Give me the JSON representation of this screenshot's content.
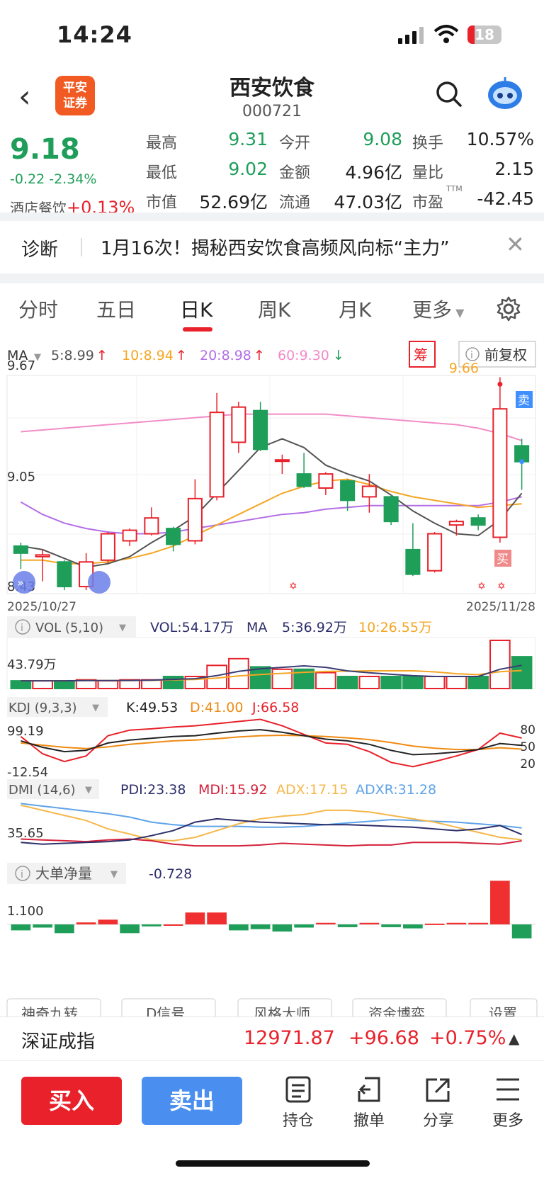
{
  "status": {
    "time": "14:24",
    "battery": "18"
  },
  "header": {
    "back_icon": "chevron-left-icon",
    "logo_text_1": "平安",
    "logo_text_2": "证券",
    "title": "西安饮食",
    "code": "000721",
    "search_icon": "search-icon",
    "bot_icon": "robot-icon"
  },
  "quote": {
    "price": "9.18",
    "change": "-0.22",
    "change_pct": "-2.34%",
    "sector_label": "酒店餐饮",
    "sector_change": "+0.13%",
    "high_label": "最高",
    "high": "9.31",
    "open_label": "今开",
    "open": "9.08",
    "turnover_label": "换手",
    "turnover": "10.57%",
    "low_label": "最低",
    "low": "9.02",
    "amount_label": "金额",
    "amount": "4.96亿",
    "vol_ratio_label": "量比",
    "vol_ratio": "2.15",
    "mktcap_label": "市值",
    "mktcap": "52.69亿",
    "float_label": "流通",
    "float_cap": "47.03亿",
    "pe_label": "市盈",
    "pe_sup": "TTM",
    "pe": "-42.45"
  },
  "diagnosis": {
    "label": "诊断",
    "text": "1月16次！揭秘西安饮食高频风向标“主力”",
    "close_icon": "close-icon"
  },
  "tabs": [
    {
      "label": "分时"
    },
    {
      "label": "五日"
    },
    {
      "label": "日K"
    },
    {
      "label": "周K"
    },
    {
      "label": "月K"
    },
    {
      "label": "更多"
    }
  ],
  "tab_settings_icon": "gear-icon",
  "ma_row": {
    "label": "MA",
    "ma5": "5:8.99",
    "ma10": "10:8.94",
    "ma20": "20:8.98",
    "ma60": "60:9.30",
    "chip": "筹",
    "adjust": "前复权"
  },
  "colors": {
    "up": "#e8212a",
    "down": "#1f9e5a",
    "ma5": "#555555",
    "ma10": "#f5a623",
    "ma20": "#b36ee6",
    "ma60": "#f28cc8",
    "blue": "#3f8fff"
  },
  "chart_data": {
    "type": "candlestick",
    "y_max_label": "9.67",
    "y_mid_label": "9.05",
    "y_min_label": "8.43",
    "ylim": [
      8.43,
      9.67
    ],
    "date_start": "2025/10/27",
    "date_end": "2025/11/28",
    "high_marker": "9.66",
    "sell_tag": "卖",
    "buy_tag": "买",
    "candles": [
      {
        "o": 8.7,
        "c": 8.66,
        "h": 8.72,
        "l": 8.57
      },
      {
        "o": 8.64,
        "c": 8.65,
        "h": 8.68,
        "l": 8.5
      },
      {
        "o": 8.61,
        "c": 8.47,
        "h": 8.62,
        "l": 8.45
      },
      {
        "o": 8.47,
        "c": 8.61,
        "h": 8.66,
        "l": 8.45
      },
      {
        "o": 8.62,
        "c": 8.77,
        "h": 8.78,
        "l": 8.6
      },
      {
        "o": 8.73,
        "c": 8.79,
        "h": 8.8,
        "l": 8.7
      },
      {
        "o": 8.77,
        "c": 8.86,
        "h": 8.92,
        "l": 8.76
      },
      {
        "o": 8.8,
        "c": 8.71,
        "h": 8.81,
        "l": 8.67
      },
      {
        "o": 8.73,
        "c": 8.97,
        "h": 9.08,
        "l": 8.71
      },
      {
        "o": 8.98,
        "c": 9.46,
        "h": 9.57,
        "l": 8.96
      },
      {
        "o": 9.29,
        "c": 9.49,
        "h": 9.52,
        "l": 9.23
      },
      {
        "o": 9.47,
        "c": 9.25,
        "h": 9.52,
        "l": 9.24
      },
      {
        "o": 9.19,
        "c": 9.19,
        "h": 9.22,
        "l": 9.11
      },
      {
        "o": 9.11,
        "c": 9.04,
        "h": 9.23,
        "l": 9.03
      },
      {
        "o": 9.03,
        "c": 9.11,
        "h": 9.12,
        "l": 8.99
      },
      {
        "o": 9.07,
        "c": 8.96,
        "h": 9.08,
        "l": 8.9
      },
      {
        "o": 8.98,
        "c": 9.04,
        "h": 9.11,
        "l": 8.89
      },
      {
        "o": 8.98,
        "c": 8.84,
        "h": 8.99,
        "l": 8.82
      },
      {
        "o": 8.68,
        "c": 8.54,
        "h": 8.83,
        "l": 8.53
      },
      {
        "o": 8.56,
        "c": 8.77,
        "h": 8.78,
        "l": 8.55
      },
      {
        "o": 8.82,
        "c": 8.84,
        "h": 8.85,
        "l": 8.76
      },
      {
        "o": 8.86,
        "c": 8.82,
        "h": 8.88,
        "l": 8.79
      },
      {
        "o": 8.75,
        "c": 9.48,
        "h": 9.66,
        "l": 8.72
      },
      {
        "o": 9.27,
        "c": 9.18,
        "h": 9.31,
        "l": 9.02
      }
    ],
    "ma5_line": [
      8.7,
      8.68,
      8.63,
      8.58,
      8.6,
      8.64,
      8.72,
      8.79,
      8.87,
      9.0,
      9.13,
      9.26,
      9.31,
      9.26,
      9.16,
      9.11,
      9.07,
      8.99,
      8.9,
      8.83,
      8.77,
      8.76,
      8.85,
      9.0
    ],
    "ma10_line": [
      8.62,
      8.62,
      8.6,
      8.6,
      8.61,
      8.63,
      8.66,
      8.7,
      8.76,
      8.82,
      8.88,
      8.94,
      9.0,
      9.04,
      9.07,
      9.08,
      9.05,
      9.01,
      8.98,
      8.96,
      8.94,
      8.92,
      8.93,
      8.94
    ],
    "ma20_line": [
      8.95,
      8.88,
      8.83,
      8.8,
      8.78,
      8.77,
      8.77,
      8.78,
      8.8,
      8.82,
      8.84,
      8.86,
      8.88,
      8.89,
      8.91,
      8.92,
      8.93,
      8.93,
      8.93,
      8.93,
      8.93,
      8.93,
      8.95,
      8.98
    ],
    "ma60_line": [
      9.35,
      9.36,
      9.37,
      9.38,
      9.39,
      9.4,
      9.41,
      9.42,
      9.43,
      9.44,
      9.45,
      9.45,
      9.45,
      9.45,
      9.45,
      9.44,
      9.43,
      9.42,
      9.41,
      9.4,
      9.39,
      9.37,
      9.34,
      9.3
    ]
  },
  "volume": {
    "label": "VOL (5,10)",
    "vol": "VOL:54.17万",
    "ma_label": "MA",
    "ma5": "5:36.92万",
    "ma10": "10:26.55万",
    "axis": "43.79万",
    "values": [
      0.16,
      0.16,
      0.16,
      0.18,
      0.16,
      0.18,
      0.18,
      0.25,
      0.25,
      0.48,
      0.62,
      0.45,
      0.4,
      0.4,
      0.33,
      0.25,
      0.25,
      0.25,
      0.25,
      0.25,
      0.25,
      0.25,
      1.0,
      0.66
    ]
  },
  "kdj": {
    "label": "KDJ (9,3,3)",
    "k": "K:49.53",
    "d": "D:41.00",
    "j": "J:66.58",
    "top": "99.19",
    "bottom": "-12.54",
    "r80": "80",
    "r50": "50",
    "r20": "20",
    "k_line": [
      60,
      45,
      35,
      38,
      55,
      62,
      66,
      70,
      72,
      78,
      83,
      86,
      80,
      72,
      64,
      60,
      52,
      38,
      28,
      30,
      34,
      40,
      54,
      49.53
    ],
    "d_line": [
      55,
      50,
      45,
      42,
      46,
      52,
      56,
      60,
      62,
      65,
      69,
      72,
      73,
      72,
      70,
      67,
      63,
      56,
      48,
      43,
      40,
      40,
      44,
      41.0
    ],
    "j_line": [
      70,
      30,
      12,
      25,
      72,
      85,
      88,
      92,
      95,
      100,
      105,
      110,
      95,
      75,
      55,
      52,
      35,
      10,
      0,
      12,
      25,
      40,
      78,
      66.58
    ]
  },
  "dmi": {
    "label": "DMI (14,6)",
    "pdi": "PDI:23.38",
    "mdi": "MDI:15.92",
    "adx": "ADX:17.15",
    "adxr": "ADXR:31.28",
    "axis": "35.65",
    "pdi_line": [
      14,
      12,
      13,
      14,
      15,
      17,
      22,
      28,
      38,
      42,
      40,
      38,
      37,
      36,
      35,
      35,
      34,
      33,
      32,
      30,
      28,
      30,
      34,
      23.38
    ],
    "mdi_line": [
      18,
      17,
      16,
      15,
      17,
      18,
      16,
      12,
      10,
      10,
      10,
      11,
      13,
      12,
      11,
      10,
      11,
      11,
      14,
      14,
      14,
      13,
      12,
      15.92
    ],
    "adx_line": [
      58,
      52,
      46,
      40,
      30,
      24,
      17,
      16,
      20,
      28,
      36,
      42,
      45,
      47,
      52,
      52,
      50,
      46,
      42,
      38,
      32,
      26,
      20,
      17.15
    ],
    "adxr_line": [
      60,
      57,
      54,
      51,
      48,
      44,
      38,
      35,
      33,
      33,
      33,
      32,
      32,
      33,
      35,
      37,
      39,
      41,
      40,
      39,
      38,
      36,
      34,
      31.28
    ]
  },
  "bigorder": {
    "label": "大单净量",
    "value": "-0.728",
    "axis": "1.100",
    "values": [
      -0.15,
      -0.08,
      -0.22,
      0.05,
      0.12,
      -0.22,
      -0.05,
      0.0,
      0.3,
      0.3,
      -0.15,
      -0.12,
      -0.18,
      -0.08,
      0.04,
      -0.07,
      0.04,
      -0.07,
      -0.1,
      0.02,
      0.04,
      0.04,
      1.1,
      -0.35
    ]
  },
  "indicator_buttons": [
    "神奇九转",
    "D信号",
    "风格大师",
    "资金博弈",
    "设置"
  ],
  "index_bar": {
    "name": "深证成指",
    "value": "12971.87",
    "change": "+96.68",
    "pct": "+0.75%"
  },
  "actions": {
    "buy": "买入",
    "sell": "卖出",
    "hold": "持仓",
    "cancel": "撤单",
    "share": "分享",
    "more": "更多"
  }
}
